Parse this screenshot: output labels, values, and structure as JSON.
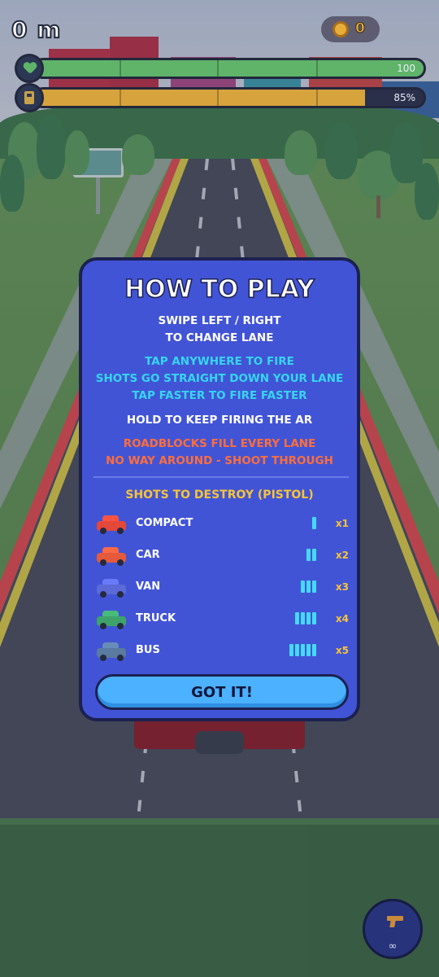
{
  "hud": {
    "distance": "0 m",
    "coins": "0",
    "health": {
      "label": "100",
      "fill_percent": 100
    },
    "fuel": {
      "label": "85%",
      "fill_percent": 85
    }
  },
  "modal": {
    "title": "HOW TO PLAY",
    "swipe_line1": "SWIPE LEFT / RIGHT",
    "swipe_line2": "TO CHANGE LANE",
    "fire_line1": "TAP ANYWHERE TO FIRE",
    "fire_line2": "SHOTS GO STRAIGHT DOWN YOUR LANE",
    "fire_line3": "TAP FASTER TO FIRE FASTER",
    "hold_line": "HOLD TO KEEP FIRING THE AR",
    "roadblock_line1": "ROADBLOCKS FILL EVERY LANE",
    "roadblock_line2": "NO WAY AROUND - SHOOT THROUGH",
    "shots_title": "SHOTS TO DESTROY (PISTOL)",
    "vehicles": [
      {
        "name": "COMPACT",
        "shots": 1,
        "multiplier": "x1",
        "color": "#e3483a",
        "icon": "compact-car-icon"
      },
      {
        "name": "CAR",
        "shots": 2,
        "multiplier": "x2",
        "color": "#e55a3c",
        "icon": "car-icon"
      },
      {
        "name": "VAN",
        "shots": 3,
        "multiplier": "x3",
        "color": "#5b6ad8",
        "icon": "van-icon"
      },
      {
        "name": "TRUCK",
        "shots": 4,
        "multiplier": "x4",
        "color": "#3ea36b",
        "icon": "truck-icon"
      },
      {
        "name": "BUS",
        "shots": 5,
        "multiplier": "x5",
        "color": "#5a7aa0",
        "icon": "bus-icon"
      }
    ],
    "button_label": "GOT IT!"
  },
  "weapon": {
    "icon": "pistol-icon",
    "ammo": "∞"
  },
  "colors": {
    "modal_bg": "#4254d6",
    "cyan_text": "#36d6ef",
    "orange_text": "#ff6e3a",
    "yellow_text": "#f7c437",
    "health_bar": "#5fb46a",
    "fuel_bar": "#d7a33c",
    "button": "#4cb1ff"
  }
}
